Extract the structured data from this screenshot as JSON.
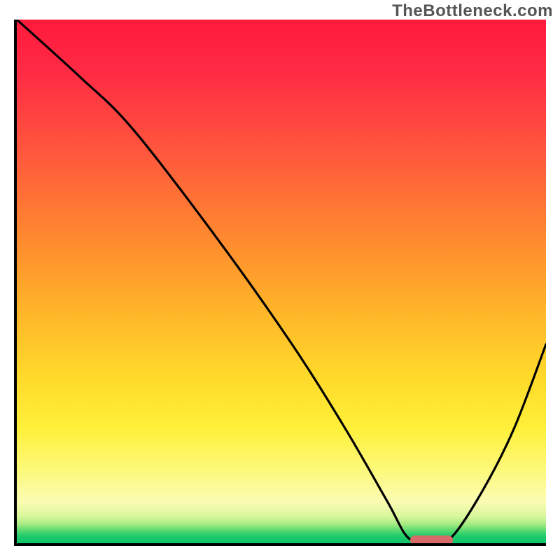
{
  "watermark": "TheBottleneck.com",
  "chart_data": {
    "type": "line",
    "title": "",
    "xlabel": "",
    "ylabel": "",
    "xlim": [
      0,
      100
    ],
    "ylim": [
      0,
      100
    ],
    "grid": false,
    "legend": false,
    "series": [
      {
        "name": "curve",
        "x": [
          0,
          12,
          22,
          38,
          52,
          62,
          70,
          74,
          78,
          82,
          88,
          94,
          100
        ],
        "values": [
          100,
          89,
          79,
          58,
          38,
          22,
          8,
          1,
          0.5,
          1,
          10,
          22,
          38
        ]
      }
    ],
    "annotations": [
      {
        "name": "optimal-marker",
        "x_start": 74,
        "x_end": 82,
        "y": 0.5,
        "color": "#d96a6a"
      }
    ],
    "background_gradient_stops": [
      {
        "pos": 0,
        "color": "#ff1a3c"
      },
      {
        "pos": 42,
        "color": "#ff8a2f"
      },
      {
        "pos": 68,
        "color": "#ffd92a"
      },
      {
        "pos": 92,
        "color": "#fbfcb3"
      },
      {
        "pos": 100,
        "color": "#0fc469"
      }
    ]
  }
}
